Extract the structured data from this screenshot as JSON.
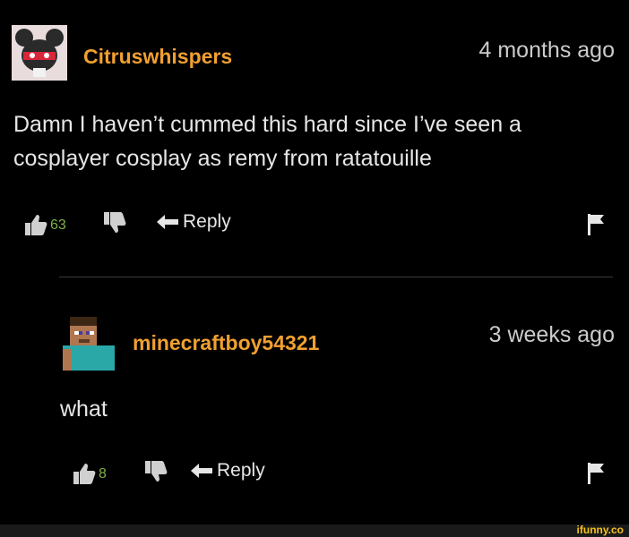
{
  "comments": [
    {
      "username": "Citruswhispers",
      "time": "4 months ago",
      "text": "Damn I haven’t cummed this hard since I’ve seen a cosplayer cosplay as remy from ratatouille",
      "upvotes": "63",
      "reply_label": "Reply"
    },
    {
      "username": "minecraftboy54321",
      "time": "3 weeks ago",
      "text": "what",
      "upvotes": "8",
      "reply_label": "Reply"
    }
  ],
  "watermark": "ifunny.co",
  "colors": {
    "background": "#000000",
    "username": "#f0a030",
    "upvote_count": "#7fb04a",
    "watermark": "#f4c21c"
  }
}
